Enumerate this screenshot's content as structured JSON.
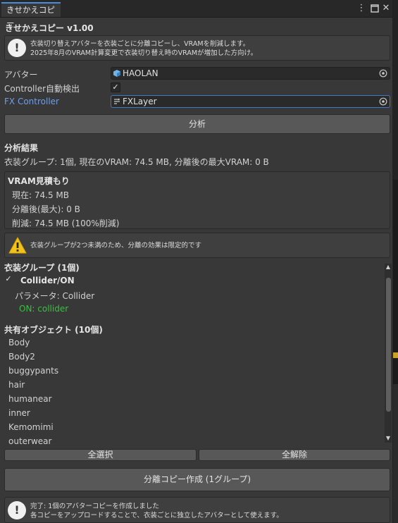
{
  "window": {
    "tab_title": "きせかえコピー",
    "menu_icon": "kebab-menu-icon",
    "maximize_icon": "maximize-icon",
    "close_icon": "close-icon"
  },
  "header": {
    "title": "きせかえコピー v1.00",
    "info_line1": "衣装切り替えアバターを衣装ごとに分離コピーし、VRAMを削減します。",
    "info_line2": "2025年8月のVRAM計算変更で衣装切り替え時のVRAMが増加した方向け。"
  },
  "fields": {
    "avatar_label": "アバター",
    "avatar_value": "HAOLAN",
    "autodetect_label": "Controller自動検出",
    "autodetect_checked": true,
    "fx_label": "FX Controller",
    "fx_value": "FXLayer"
  },
  "analyze_button": "分析",
  "results": {
    "heading": "分析結果",
    "summary": "衣装グループ: 1個, 現在のVRAM: 74.5 MB, 分離後の最大VRAM: 0 B",
    "vram_title": "VRAM見積もり",
    "vram_current": "現在: 74.5 MB",
    "vram_after": "分離後(最大): 0 B",
    "vram_reduction": "削減: 74.5 MB (100%削減)",
    "warning": "衣装グループが2つ未満のため、分離の効果は限定的です"
  },
  "groups": {
    "heading": "衣装グループ (1個)",
    "item_name": "Collider/ON",
    "item_checked": true,
    "param": "パラメータ: Collider",
    "on_value": "ON: collider"
  },
  "shared": {
    "heading": "共有オブジェクト (10個)",
    "items": [
      "Body",
      "Body2",
      "buggypants",
      "hair",
      "humanear",
      "inner",
      "Kemomimi",
      "outerwear"
    ]
  },
  "select_all": "全選択",
  "deselect_all": "全解除",
  "create_button": "分離コピー作成 (1グループ)",
  "status": {
    "line1": "完了: 1個のアバターコピーを作成しました",
    "line2": "各コピーをアップロードすることで、衣装ごとに独立したアバターとして使えます。"
  },
  "colors": {
    "link_blue": "#6f9ee8",
    "on_green": "#39c13e",
    "warning_yellow": "#f2c21b",
    "tab_accent": "#4a8cd6"
  }
}
